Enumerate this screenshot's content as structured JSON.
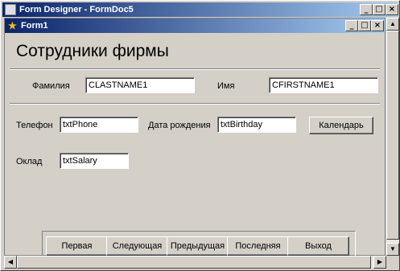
{
  "app": {
    "title": "Form Designer - FormDoc5"
  },
  "form": {
    "title": "Form1",
    "heading": "Сотрудники фирмы",
    "fields": {
      "lastname_label": "Фамилия",
      "lastname_value": "CLASTNAME1",
      "firstname_label": "Имя",
      "firstname_value": "CFIRSTNAME1",
      "phone_label": "Телефон",
      "phone_value": "txtPhone",
      "birthday_label": "Дата рождения",
      "birthday_value": "txtBirthday",
      "salary_label": "Оклад",
      "salary_value": "txtSalary"
    },
    "calendar_button": "Календарь",
    "nav": {
      "first": "Первая",
      "next": "Следующая",
      "prev": "Предыдущая",
      "last": "Последняя",
      "exit": "Выход"
    }
  },
  "caption_buttons": {
    "minimize": "_",
    "maximize": "□",
    "close": "×"
  }
}
